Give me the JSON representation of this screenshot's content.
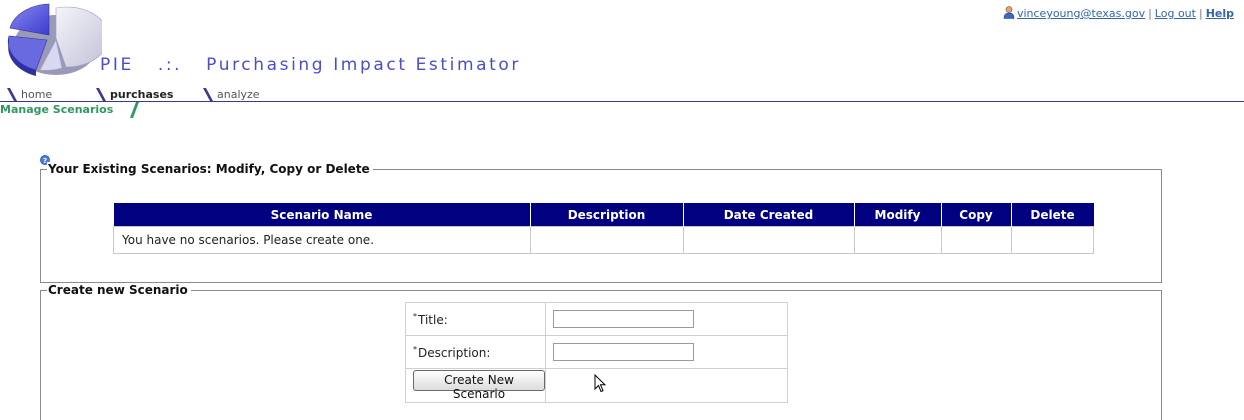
{
  "header": {
    "app_title": "PIE   .:.   Purchasing Impact Estimator",
    "user_email": "vinceyoung@texas.gov",
    "logout_label": "Log out",
    "help_label": "Help",
    "separator": "|"
  },
  "nav": {
    "tabs": [
      {
        "label": "home",
        "active": false
      },
      {
        "label": "purchases",
        "active": true
      },
      {
        "label": "analyze",
        "active": false
      }
    ],
    "subtab": "Manage Scenarios"
  },
  "existing": {
    "legend": "Your Existing Scenarios: Modify, Copy or Delete",
    "columns": [
      "Scenario Name",
      "Description",
      "Date Created",
      "Modify",
      "Copy",
      "Delete"
    ],
    "empty_message": "You have no scenarios. Please create one."
  },
  "create": {
    "legend": "Create new Scenario",
    "required_mark": "*",
    "title_label": "Title:",
    "title_value": "",
    "description_label": "Description:",
    "description_value": "",
    "button_label": "Create New Scenario"
  },
  "colors": {
    "table_header": "#000080",
    "title_blue": "#4d4dcc",
    "subtab_green": "#2e9a5e",
    "link_blue": "#3366aa"
  },
  "icons": [
    "user-icon",
    "pie-logo",
    "help-question-icon",
    "mouse-cursor-icon"
  ]
}
